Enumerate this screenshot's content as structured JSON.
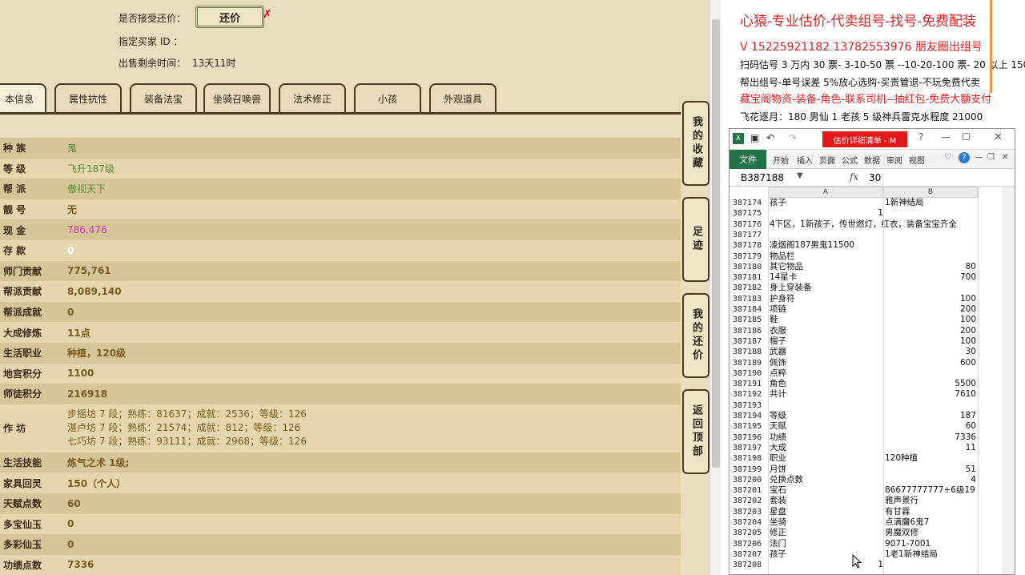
{
  "game": {
    "offer_label": "是否接受还价：",
    "offer_button": "还价",
    "buyer_label": "指定买家 ID ：",
    "time_label": "出售剩余时间：",
    "time_value": "13天11时",
    "tabs": [
      "本信息",
      "属性抗性",
      "装备法宝",
      "坐骑召唤兽",
      "法术修正",
      "小孩",
      "外观道具"
    ],
    "rows": [
      {
        "label": "种  族",
        "value": "鬼",
        "style": "green"
      },
      {
        "label": "等  级",
        "value": "飞升187级",
        "style": "green"
      },
      {
        "label": "帮  派",
        "value": "傲视天下",
        "style": "green"
      },
      {
        "label": "靓  号",
        "value": "无",
        "style": ""
      },
      {
        "label": "现  金",
        "value": "786,476",
        "style": "magenta"
      },
      {
        "label": "存  款",
        "value": "0",
        "style": "white"
      },
      {
        "label": "师门贡献",
        "value": "775,761",
        "style": ""
      },
      {
        "label": "帮派贡献",
        "value": "8,089,140",
        "style": ""
      },
      {
        "label": "帮派成就",
        "value": "0",
        "style": ""
      },
      {
        "label": "大成修炼",
        "value": "11点",
        "style": ""
      },
      {
        "label": "生活职业",
        "value": "种植，120级",
        "style": ""
      },
      {
        "label": "地宫积分",
        "value": "1100",
        "style": ""
      },
      {
        "label": "师徒积分",
        "value": "216918",
        "style": ""
      }
    ],
    "workshop_label": "作  坊",
    "workshop_lines": [
      "步摇坊 7 段；熟练：81637；成就：2536；等级：126",
      "湛卢坊 7 段；熟练：21574；成就：812；等级：126",
      "七巧坊 7 段；熟练：93111；成就：2968；等级：126"
    ],
    "rows2": [
      {
        "label": "生活技能",
        "value": "炼气之术 1级;",
        "style": ""
      },
      {
        "label": "家具回灵",
        "value": "150（个人）",
        "style": ""
      },
      {
        "label": "天赋点数",
        "value": "60",
        "style": ""
      },
      {
        "label": "多宝仙玉",
        "value": "0",
        "style": ""
      },
      {
        "label": "多彩仙玉",
        "value": "0",
        "style": ""
      },
      {
        "label": "功绩点数",
        "value": "7336",
        "style": ""
      }
    ],
    "side_buttons": [
      "我的收藏",
      "足迹",
      "我的还价",
      "返回顶部"
    ]
  },
  "doc": {
    "line1": "心猿-专业估价-代卖组号-找号-免费配装",
    "line2": "V 15225921182   13782553976 朋友圈出组号",
    "line3": "扫码估号 3 万内 30 票- 3-10-50 票  --10-20-100 票- 20 以上 150",
    "line4": "帮出组号-单号误差 5%放心选购-买贵管退-不玩免费代卖",
    "line5": "藏宝阁物资-装备-角色-联系司机--抽红包-免费大额支付",
    "line6": "飞花逐月：180 男仙 1 老孩 5 级神兵雷克水程度 21000"
  },
  "excel": {
    "title_tab": "估价详细清单 - M",
    "ribbon": [
      "文件",
      "开始",
      "插入",
      "页面",
      "公式",
      "数据",
      "审阅",
      "视图"
    ],
    "name_box": "B387188",
    "fx": "fx",
    "formula_value": "30",
    "col_a": "A",
    "col_b": "B",
    "rows": [
      [
        "387174",
        "孩子",
        "1新神结局"
      ],
      [
        "387175",
        "1",
        ""
      ],
      [
        "387176",
        "4下区，1新孩子，传世燃灯，红衣，装备宝宝齐全",
        ""
      ],
      [
        "387177",
        "",
        ""
      ],
      [
        "387178",
        "凌烟阁187男鬼11500",
        ""
      ],
      [
        "387179",
        "物品栏",
        ""
      ],
      [
        "387180",
        "其它物品",
        "80"
      ],
      [
        "387181",
        "14星卡",
        "700"
      ],
      [
        "387182",
        "身上穿装备",
        ""
      ],
      [
        "387183",
        "护身符",
        "100"
      ],
      [
        "387184",
        "项链",
        "200"
      ],
      [
        "387185",
        "鞋",
        "100"
      ],
      [
        "387186",
        "衣服",
        "200"
      ],
      [
        "387187",
        "帽子",
        "100"
      ],
      [
        "387188",
        "武器",
        "30"
      ],
      [
        "387189",
        "佩饰",
        "600"
      ],
      [
        "387190",
        "点粹",
        ""
      ],
      [
        "387191",
        "角色",
        "5500"
      ],
      [
        "387192",
        "共计",
        "7610"
      ],
      [
        "387193",
        "",
        ""
      ],
      [
        "387194",
        "等级",
        "187"
      ],
      [
        "387195",
        "天赋",
        "60"
      ],
      [
        "387196",
        "功绩",
        "7336"
      ],
      [
        "387197",
        "大成",
        "11"
      ],
      [
        "387198",
        "职业",
        "120种植"
      ],
      [
        "387199",
        "月饼",
        "51"
      ],
      [
        "387200",
        "兑换点数",
        "4"
      ],
      [
        "387201",
        "宝石",
        "86677777777+6级19"
      ],
      [
        "387202",
        "套装",
        "雅声景行"
      ],
      [
        "387203",
        "星盘",
        "有甘霖"
      ],
      [
        "387204",
        "坐骑",
        "点满魔6鬼7"
      ],
      [
        "387205",
        "修正",
        "男魔双修"
      ],
      [
        "387206",
        "法门",
        "9071-7001"
      ],
      [
        "387207",
        "孩子",
        "1老1新神结局"
      ],
      [
        "387208",
        "1",
        ""
      ]
    ]
  }
}
